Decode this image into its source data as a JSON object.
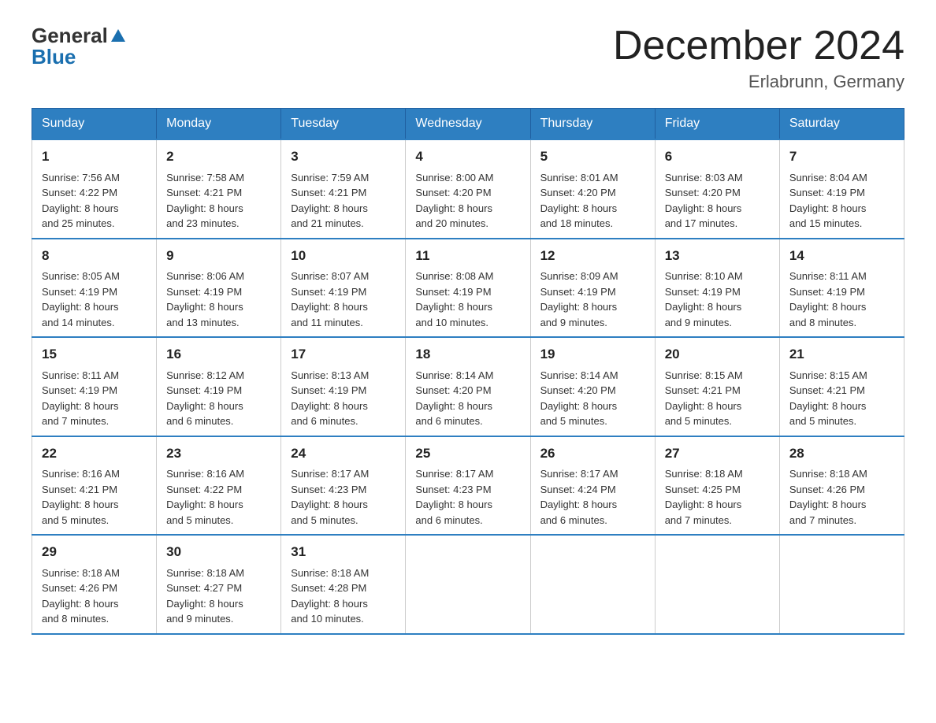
{
  "header": {
    "logo_general": "General",
    "logo_blue": "Blue",
    "title": "December 2024",
    "subtitle": "Erlabrunn, Germany"
  },
  "days_of_week": [
    "Sunday",
    "Monday",
    "Tuesday",
    "Wednesday",
    "Thursday",
    "Friday",
    "Saturday"
  ],
  "weeks": [
    [
      {
        "day": "1",
        "sunrise": "7:56 AM",
        "sunset": "4:22 PM",
        "daylight": "8 hours and 25 minutes."
      },
      {
        "day": "2",
        "sunrise": "7:58 AM",
        "sunset": "4:21 PM",
        "daylight": "8 hours and 23 minutes."
      },
      {
        "day": "3",
        "sunrise": "7:59 AM",
        "sunset": "4:21 PM",
        "daylight": "8 hours and 21 minutes."
      },
      {
        "day": "4",
        "sunrise": "8:00 AM",
        "sunset": "4:20 PM",
        "daylight": "8 hours and 20 minutes."
      },
      {
        "day": "5",
        "sunrise": "8:01 AM",
        "sunset": "4:20 PM",
        "daylight": "8 hours and 18 minutes."
      },
      {
        "day": "6",
        "sunrise": "8:03 AM",
        "sunset": "4:20 PM",
        "daylight": "8 hours and 17 minutes."
      },
      {
        "day": "7",
        "sunrise": "8:04 AM",
        "sunset": "4:19 PM",
        "daylight": "8 hours and 15 minutes."
      }
    ],
    [
      {
        "day": "8",
        "sunrise": "8:05 AM",
        "sunset": "4:19 PM",
        "daylight": "8 hours and 14 minutes."
      },
      {
        "day": "9",
        "sunrise": "8:06 AM",
        "sunset": "4:19 PM",
        "daylight": "8 hours and 13 minutes."
      },
      {
        "day": "10",
        "sunrise": "8:07 AM",
        "sunset": "4:19 PM",
        "daylight": "8 hours and 11 minutes."
      },
      {
        "day": "11",
        "sunrise": "8:08 AM",
        "sunset": "4:19 PM",
        "daylight": "8 hours and 10 minutes."
      },
      {
        "day": "12",
        "sunrise": "8:09 AM",
        "sunset": "4:19 PM",
        "daylight": "8 hours and 9 minutes."
      },
      {
        "day": "13",
        "sunrise": "8:10 AM",
        "sunset": "4:19 PM",
        "daylight": "8 hours and 9 minutes."
      },
      {
        "day": "14",
        "sunrise": "8:11 AM",
        "sunset": "4:19 PM",
        "daylight": "8 hours and 8 minutes."
      }
    ],
    [
      {
        "day": "15",
        "sunrise": "8:11 AM",
        "sunset": "4:19 PM",
        "daylight": "8 hours and 7 minutes."
      },
      {
        "day": "16",
        "sunrise": "8:12 AM",
        "sunset": "4:19 PM",
        "daylight": "8 hours and 6 minutes."
      },
      {
        "day": "17",
        "sunrise": "8:13 AM",
        "sunset": "4:19 PM",
        "daylight": "8 hours and 6 minutes."
      },
      {
        "day": "18",
        "sunrise": "8:14 AM",
        "sunset": "4:20 PM",
        "daylight": "8 hours and 6 minutes."
      },
      {
        "day": "19",
        "sunrise": "8:14 AM",
        "sunset": "4:20 PM",
        "daylight": "8 hours and 5 minutes."
      },
      {
        "day": "20",
        "sunrise": "8:15 AM",
        "sunset": "4:21 PM",
        "daylight": "8 hours and 5 minutes."
      },
      {
        "day": "21",
        "sunrise": "8:15 AM",
        "sunset": "4:21 PM",
        "daylight": "8 hours and 5 minutes."
      }
    ],
    [
      {
        "day": "22",
        "sunrise": "8:16 AM",
        "sunset": "4:21 PM",
        "daylight": "8 hours and 5 minutes."
      },
      {
        "day": "23",
        "sunrise": "8:16 AM",
        "sunset": "4:22 PM",
        "daylight": "8 hours and 5 minutes."
      },
      {
        "day": "24",
        "sunrise": "8:17 AM",
        "sunset": "4:23 PM",
        "daylight": "8 hours and 5 minutes."
      },
      {
        "day": "25",
        "sunrise": "8:17 AM",
        "sunset": "4:23 PM",
        "daylight": "8 hours and 6 minutes."
      },
      {
        "day": "26",
        "sunrise": "8:17 AM",
        "sunset": "4:24 PM",
        "daylight": "8 hours and 6 minutes."
      },
      {
        "day": "27",
        "sunrise": "8:18 AM",
        "sunset": "4:25 PM",
        "daylight": "8 hours and 7 minutes."
      },
      {
        "day": "28",
        "sunrise": "8:18 AM",
        "sunset": "4:26 PM",
        "daylight": "8 hours and 7 minutes."
      }
    ],
    [
      {
        "day": "29",
        "sunrise": "8:18 AM",
        "sunset": "4:26 PM",
        "daylight": "8 hours and 8 minutes."
      },
      {
        "day": "30",
        "sunrise": "8:18 AM",
        "sunset": "4:27 PM",
        "daylight": "8 hours and 9 minutes."
      },
      {
        "day": "31",
        "sunrise": "8:18 AM",
        "sunset": "4:28 PM",
        "daylight": "8 hours and 10 minutes."
      },
      null,
      null,
      null,
      null
    ]
  ],
  "labels": {
    "sunrise": "Sunrise: ",
    "sunset": "Sunset: ",
    "daylight": "Daylight: "
  }
}
